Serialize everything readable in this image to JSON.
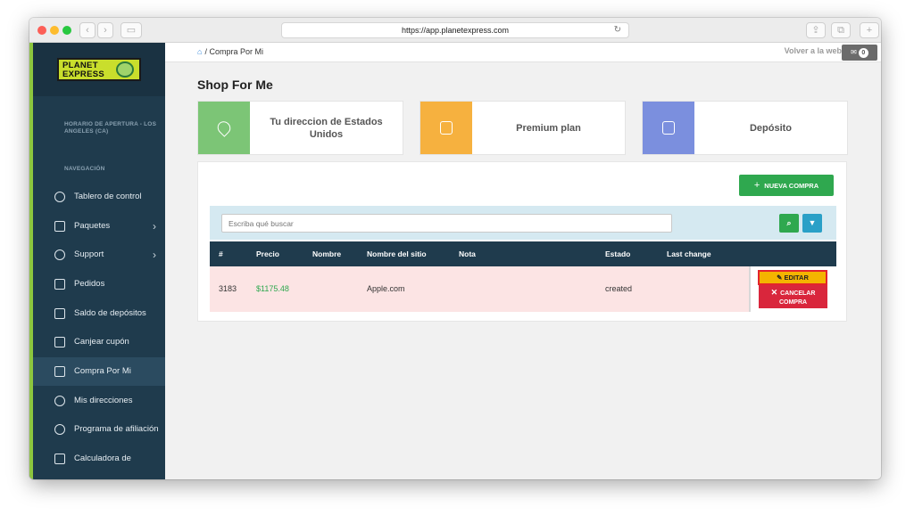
{
  "browser": {
    "url": "https://app.planetexpress.com"
  },
  "sidebar": {
    "logo_text_line1": "PLANET",
    "logo_text_line2": "EXPRESS",
    "hours_label": "HORARIO DE APERTURA - LOS ANGELES (CA)",
    "nav_label": "NAVEGACIÓN",
    "items": [
      {
        "label": "Tablero de control",
        "icon": "gauge-icon"
      },
      {
        "label": "Paquetes",
        "icon": "package-icon",
        "has_submenu": true
      },
      {
        "label": "Support",
        "icon": "support-icon",
        "has_submenu": true
      },
      {
        "label": "Pedidos",
        "icon": "orders-icon"
      },
      {
        "label": "Saldo de depósitos",
        "icon": "deposit-icon"
      },
      {
        "label": "Canjear cupón",
        "icon": "coupon-icon"
      },
      {
        "label": "Compra Por Mi",
        "icon": "shopping-bag-icon",
        "active": true
      },
      {
        "label": "Mis direcciones",
        "icon": "location-pin-icon"
      },
      {
        "label": "Programa de afiliación",
        "icon": "affiliate-icon"
      },
      {
        "label": "Calculadora de",
        "icon": "calculator-icon"
      }
    ]
  },
  "topbar": {
    "breadcrumb": "/ Compra Por Mi",
    "back_link": "Volver a la web",
    "mail_count": "0"
  },
  "page": {
    "title": "Shop For Me",
    "cards": [
      {
        "title": "Tu direccion de Estados Unidos",
        "color": "#7cc576",
        "icon": "location-pin-icon"
      },
      {
        "title": "Premium plan",
        "color": "#f6b13f",
        "icon": "clipboard-icon"
      },
      {
        "title": "Depósito",
        "color": "#7b8fde",
        "icon": "deposit-box-icon"
      }
    ]
  },
  "panel": {
    "new_button": "NUEVA COMPRA",
    "search_placeholder": "Escriba qué buscar",
    "columns": [
      "#",
      "Precio",
      "Nombre",
      "Nombre del sitio",
      "Nota",
      "Estado",
      "Last change"
    ],
    "rows": [
      {
        "id": "3183",
        "price": "$1175.48",
        "name": "",
        "site": "Apple.com",
        "note": "",
        "status": "created",
        "last_change": ""
      }
    ],
    "edit_button": "EDITAR",
    "cancel_button": "CANCELAR COMPRA"
  },
  "colors": {
    "sidebar_bg": "#1f3b4d",
    "accent_green": "#2fa84f",
    "row_highlight": "#fce4e4",
    "edit_yellow": "#f4b400",
    "cancel_red": "#d9263c"
  }
}
